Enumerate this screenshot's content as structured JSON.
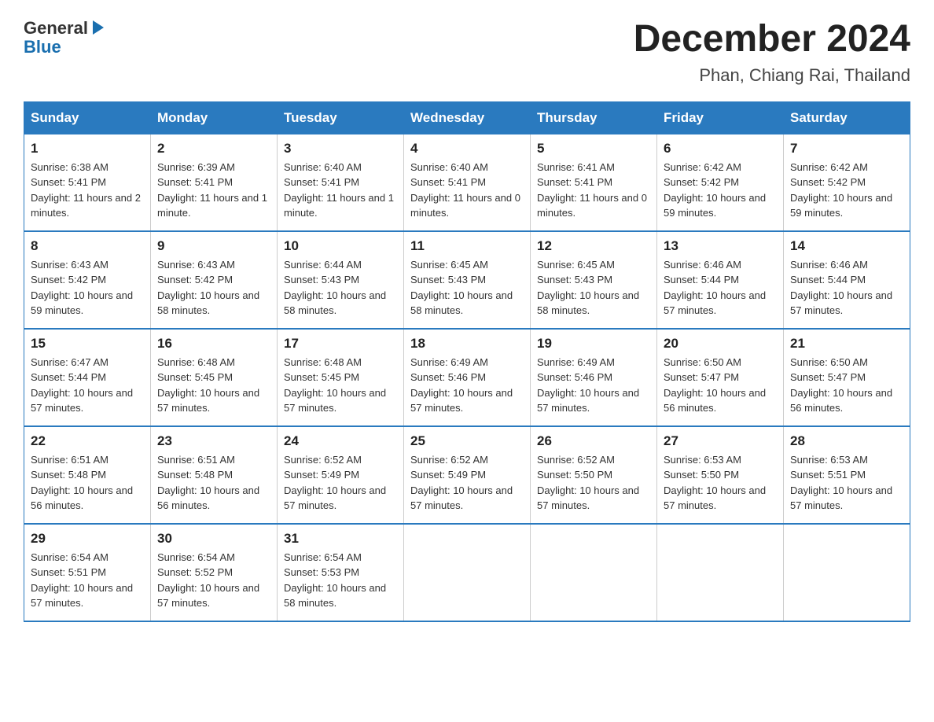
{
  "logo": {
    "text_general": "General",
    "arrow": "▶",
    "text_blue": "Blue"
  },
  "title": "December 2024",
  "subtitle": "Phan, Chiang Rai, Thailand",
  "header": {
    "days": [
      "Sunday",
      "Monday",
      "Tuesday",
      "Wednesday",
      "Thursday",
      "Friday",
      "Saturday"
    ]
  },
  "weeks": [
    [
      {
        "day": "1",
        "sunrise": "6:38 AM",
        "sunset": "5:41 PM",
        "daylight": "11 hours and 2 minutes."
      },
      {
        "day": "2",
        "sunrise": "6:39 AM",
        "sunset": "5:41 PM",
        "daylight": "11 hours and 1 minute."
      },
      {
        "day": "3",
        "sunrise": "6:40 AM",
        "sunset": "5:41 PM",
        "daylight": "11 hours and 1 minute."
      },
      {
        "day": "4",
        "sunrise": "6:40 AM",
        "sunset": "5:41 PM",
        "daylight": "11 hours and 0 minutes."
      },
      {
        "day": "5",
        "sunrise": "6:41 AM",
        "sunset": "5:41 PM",
        "daylight": "11 hours and 0 minutes."
      },
      {
        "day": "6",
        "sunrise": "6:42 AM",
        "sunset": "5:42 PM",
        "daylight": "10 hours and 59 minutes."
      },
      {
        "day": "7",
        "sunrise": "6:42 AM",
        "sunset": "5:42 PM",
        "daylight": "10 hours and 59 minutes."
      }
    ],
    [
      {
        "day": "8",
        "sunrise": "6:43 AM",
        "sunset": "5:42 PM",
        "daylight": "10 hours and 59 minutes."
      },
      {
        "day": "9",
        "sunrise": "6:43 AM",
        "sunset": "5:42 PM",
        "daylight": "10 hours and 58 minutes."
      },
      {
        "day": "10",
        "sunrise": "6:44 AM",
        "sunset": "5:43 PM",
        "daylight": "10 hours and 58 minutes."
      },
      {
        "day": "11",
        "sunrise": "6:45 AM",
        "sunset": "5:43 PM",
        "daylight": "10 hours and 58 minutes."
      },
      {
        "day": "12",
        "sunrise": "6:45 AM",
        "sunset": "5:43 PM",
        "daylight": "10 hours and 58 minutes."
      },
      {
        "day": "13",
        "sunrise": "6:46 AM",
        "sunset": "5:44 PM",
        "daylight": "10 hours and 57 minutes."
      },
      {
        "day": "14",
        "sunrise": "6:46 AM",
        "sunset": "5:44 PM",
        "daylight": "10 hours and 57 minutes."
      }
    ],
    [
      {
        "day": "15",
        "sunrise": "6:47 AM",
        "sunset": "5:44 PM",
        "daylight": "10 hours and 57 minutes."
      },
      {
        "day": "16",
        "sunrise": "6:48 AM",
        "sunset": "5:45 PM",
        "daylight": "10 hours and 57 minutes."
      },
      {
        "day": "17",
        "sunrise": "6:48 AM",
        "sunset": "5:45 PM",
        "daylight": "10 hours and 57 minutes."
      },
      {
        "day": "18",
        "sunrise": "6:49 AM",
        "sunset": "5:46 PM",
        "daylight": "10 hours and 57 minutes."
      },
      {
        "day": "19",
        "sunrise": "6:49 AM",
        "sunset": "5:46 PM",
        "daylight": "10 hours and 57 minutes."
      },
      {
        "day": "20",
        "sunrise": "6:50 AM",
        "sunset": "5:47 PM",
        "daylight": "10 hours and 56 minutes."
      },
      {
        "day": "21",
        "sunrise": "6:50 AM",
        "sunset": "5:47 PM",
        "daylight": "10 hours and 56 minutes."
      }
    ],
    [
      {
        "day": "22",
        "sunrise": "6:51 AM",
        "sunset": "5:48 PM",
        "daylight": "10 hours and 56 minutes."
      },
      {
        "day": "23",
        "sunrise": "6:51 AM",
        "sunset": "5:48 PM",
        "daylight": "10 hours and 56 minutes."
      },
      {
        "day": "24",
        "sunrise": "6:52 AM",
        "sunset": "5:49 PM",
        "daylight": "10 hours and 57 minutes."
      },
      {
        "day": "25",
        "sunrise": "6:52 AM",
        "sunset": "5:49 PM",
        "daylight": "10 hours and 57 minutes."
      },
      {
        "day": "26",
        "sunrise": "6:52 AM",
        "sunset": "5:50 PM",
        "daylight": "10 hours and 57 minutes."
      },
      {
        "day": "27",
        "sunrise": "6:53 AM",
        "sunset": "5:50 PM",
        "daylight": "10 hours and 57 minutes."
      },
      {
        "day": "28",
        "sunrise": "6:53 AM",
        "sunset": "5:51 PM",
        "daylight": "10 hours and 57 minutes."
      }
    ],
    [
      {
        "day": "29",
        "sunrise": "6:54 AM",
        "sunset": "5:51 PM",
        "daylight": "10 hours and 57 minutes."
      },
      {
        "day": "30",
        "sunrise": "6:54 AM",
        "sunset": "5:52 PM",
        "daylight": "10 hours and 57 minutes."
      },
      {
        "day": "31",
        "sunrise": "6:54 AM",
        "sunset": "5:53 PM",
        "daylight": "10 hours and 58 minutes."
      },
      null,
      null,
      null,
      null
    ]
  ]
}
